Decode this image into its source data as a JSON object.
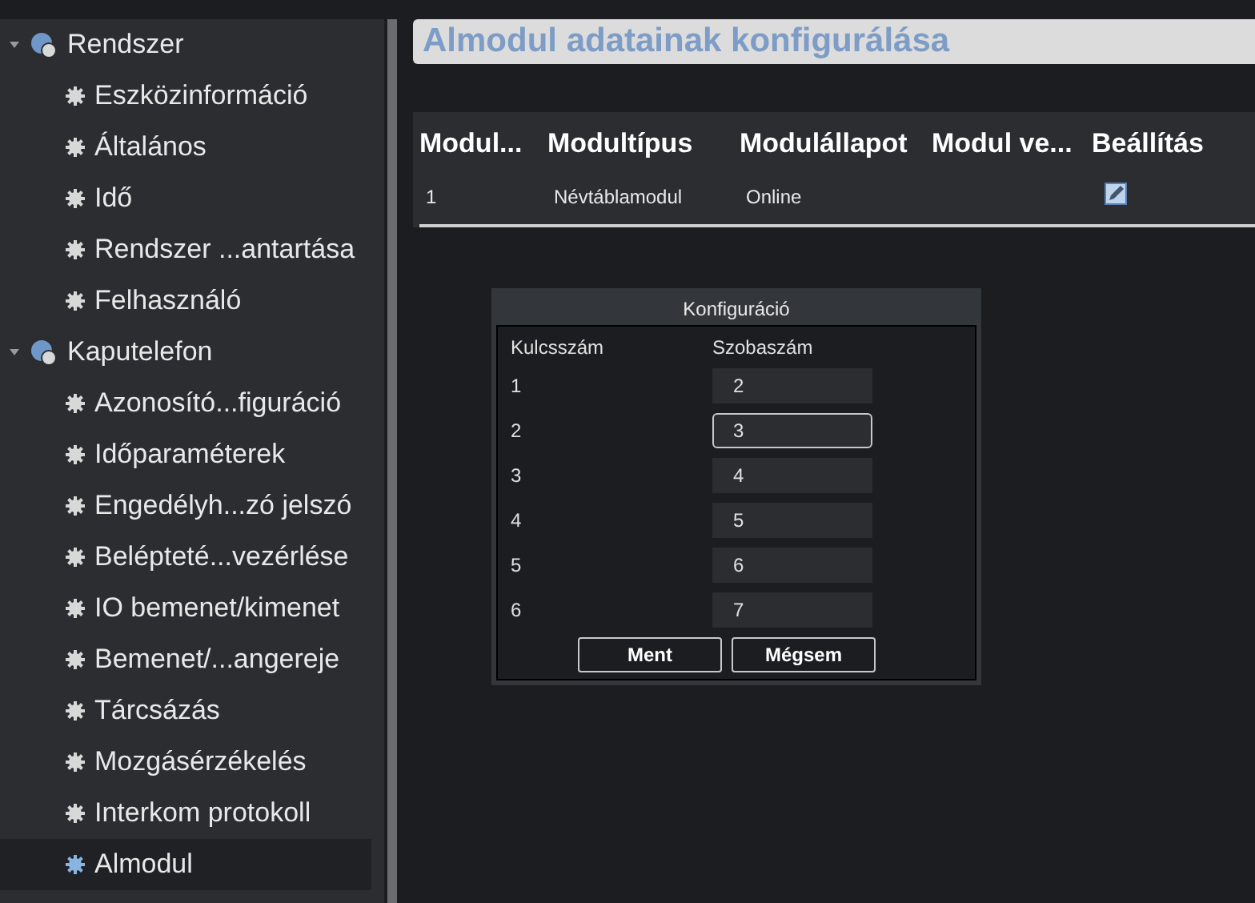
{
  "sidebar": {
    "groups": [
      {
        "label": "Rendszer",
        "expanded": true,
        "children": [
          {
            "label": "Eszközinformáció",
            "selected": false
          },
          {
            "label": "Általános",
            "selected": false
          },
          {
            "label": "Idő",
            "selected": false
          },
          {
            "label": "Rendszer ...antartása",
            "selected": false
          },
          {
            "label": "Felhasználó",
            "selected": false
          }
        ]
      },
      {
        "label": "Kaputelefon",
        "expanded": true,
        "children": [
          {
            "label": "Azonosító...figuráció",
            "selected": false
          },
          {
            "label": "Időparaméterek",
            "selected": false
          },
          {
            "label": "Engedélyh...zó jelszó",
            "selected": false
          },
          {
            "label": "Belépteté...vezérlése",
            "selected": false
          },
          {
            "label": "IO bemenet/kimenet",
            "selected": false
          },
          {
            "label": "Bemenet/...angereje",
            "selected": false
          },
          {
            "label": "Tárcsázás",
            "selected": false
          },
          {
            "label": "Mozgásérzékelés",
            "selected": false
          },
          {
            "label": "Interkom protokoll",
            "selected": false
          },
          {
            "label": "Almodul",
            "selected": true
          }
        ]
      }
    ]
  },
  "page_title": "Almodul adatainak konfigurálása",
  "table": {
    "columns": [
      "Modul...",
      "Modultípus",
      "Modulállapot",
      "Modul ve...",
      "Beállítás"
    ],
    "rows": [
      {
        "cells": [
          "1",
          "Névtáblamodul",
          "Online",
          ""
        ]
      }
    ]
  },
  "dialog": {
    "title": "Konfiguráció",
    "columns": [
      "Kulcsszám",
      "Szobaszám"
    ],
    "rows": [
      {
        "key": "1",
        "value": "2",
        "focused": false
      },
      {
        "key": "2",
        "value": "3",
        "focused": true
      },
      {
        "key": "3",
        "value": "4",
        "focused": false
      },
      {
        "key": "4",
        "value": "5",
        "focused": false
      },
      {
        "key": "5",
        "value": "6",
        "focused": false
      },
      {
        "key": "6",
        "value": "7",
        "focused": false
      }
    ],
    "buttons": [
      "Ment",
      "Mégsem"
    ]
  }
}
